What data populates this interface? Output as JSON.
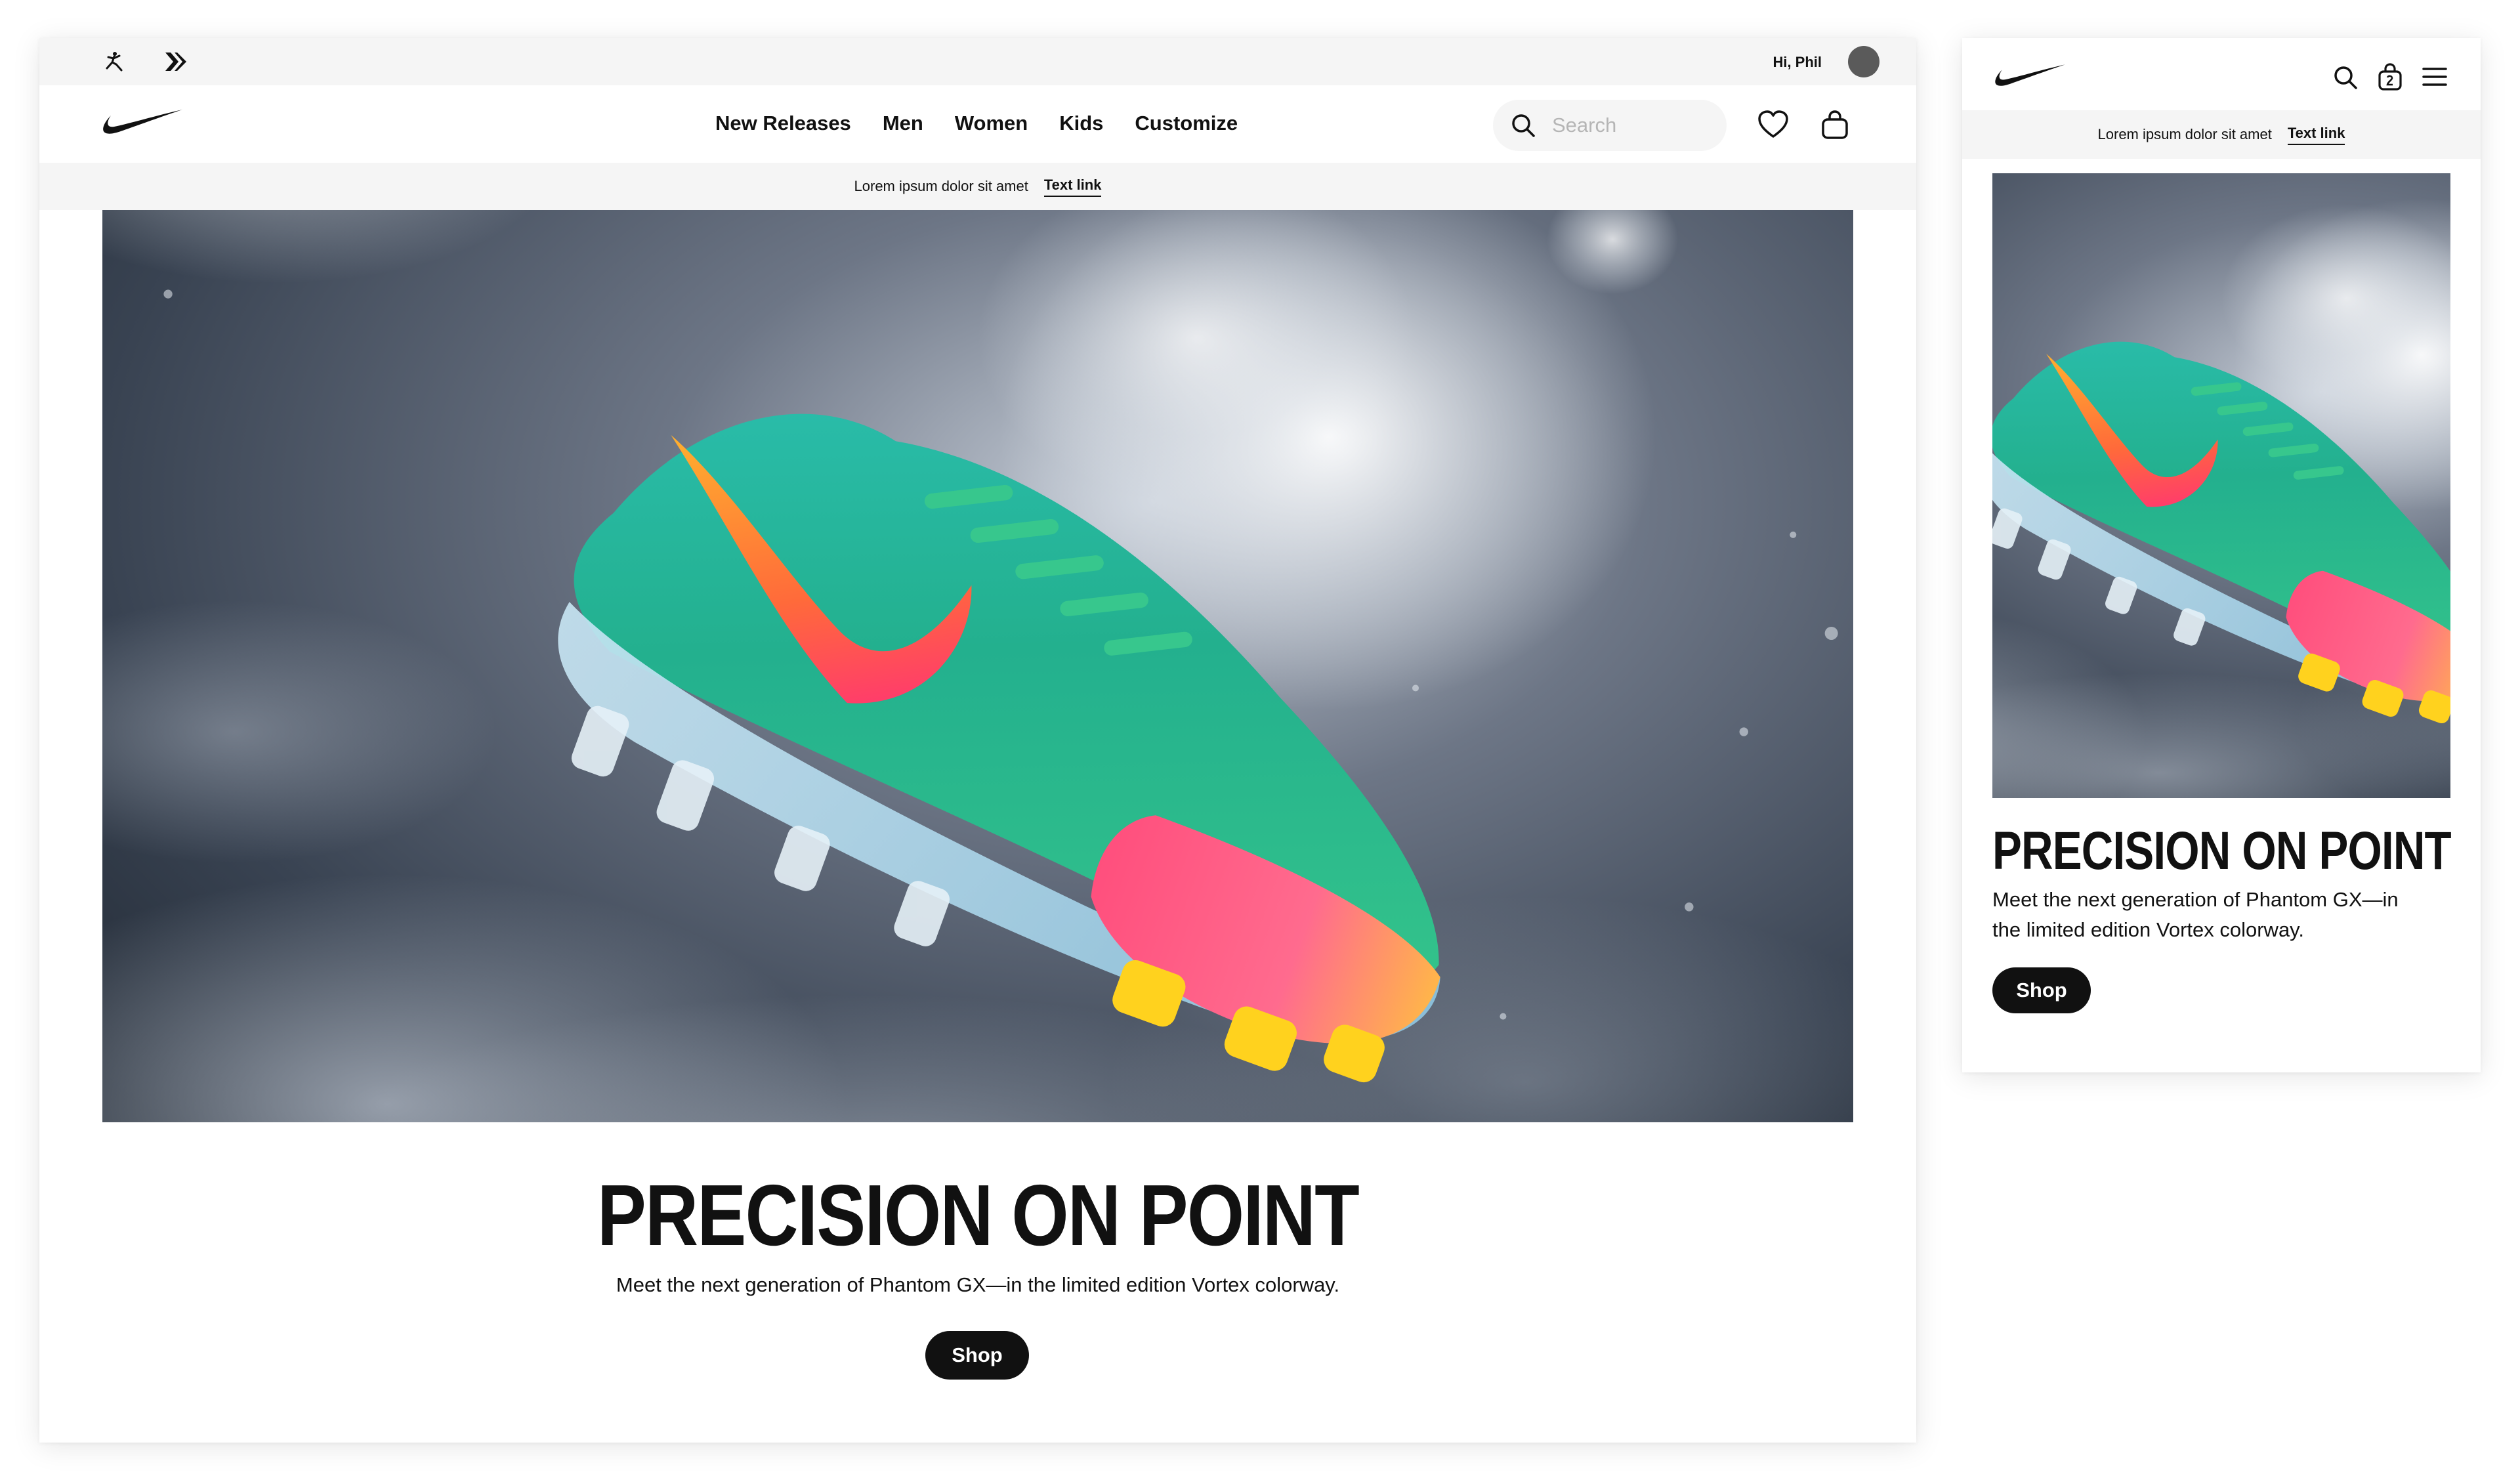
{
  "desktop": {
    "utility": {
      "greeting": "Hi, Phil",
      "icons": [
        "jordan-jumpman-icon",
        "converse-icon"
      ]
    },
    "nav": {
      "links": [
        "New Releases",
        "Men",
        "Women",
        "Kids",
        "Customize"
      ],
      "search_placeholder": "Search"
    },
    "promo": {
      "text": "Lorem ipsum dolor sit amet",
      "link": "Text link"
    },
    "hero": {
      "headline": "PRECISION ON POINT",
      "subcopy": "Meet the next generation of Phantom GX—in the limited edition Vortex colorway.",
      "cta": "Shop"
    }
  },
  "mobile": {
    "promo": {
      "text": "Lorem ipsum dolor sit amet",
      "link": "Text link"
    },
    "hero": {
      "headline": "PRECISION ON POINT",
      "subcopy": "Meet the next generation of Phantom GX—in the limited edition Vortex colorway.",
      "cta": "Shop"
    }
  },
  "colors": {
    "text": "#111111",
    "bar_bg": "#f5f5f5",
    "button_bg": "#111111",
    "button_text": "#ffffff",
    "placeholder": "#b5b5b5",
    "avatar": "#5a5a5a"
  }
}
